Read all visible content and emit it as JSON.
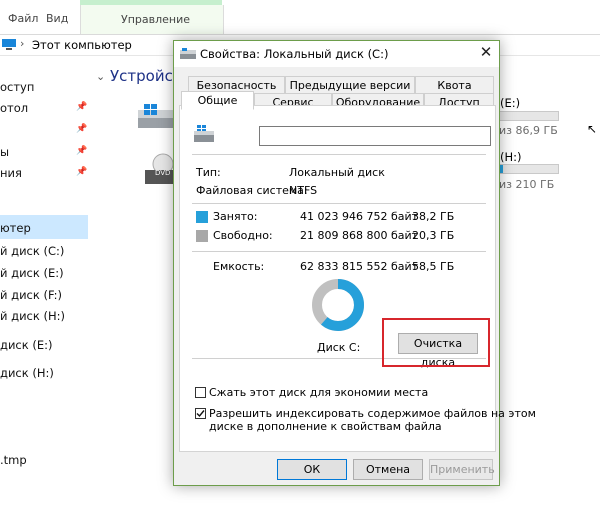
{
  "explorer": {
    "ribbon_tabs": [
      "Файл",
      "Вид"
    ],
    "context_tab_label": "Управление",
    "address_text": "Этот компьютер",
    "section_header": "Устройства",
    "nav_items": [
      "оступ",
      "отол",
      "ы",
      "ния",
      "ютер",
      "й диск (C:)",
      "й диск (E:)",
      "й диск (F:)",
      "й диск (H:)",
      "диск (E:)",
      "диск (H:)",
      ".tmp"
    ],
    "drives_right": [
      {
        "label": "(E:)",
        "free_text": "из 86,9 ГБ"
      },
      {
        "label": "(H:)",
        "free_text": "из 210 ГБ"
      }
    ],
    "dvd_label": "DVD"
  },
  "dialog": {
    "title": "Свойства: Локальный диск (C:)",
    "close_glyph": "✕",
    "tabs_row1": [
      "Безопасность",
      "Предыдущие версии",
      "Квота"
    ],
    "tabs_row2": [
      "Общие",
      "Сервис",
      "Оборудование",
      "Доступ"
    ],
    "active_tab": "Общие",
    "name_input_value": "",
    "type_label": "Тип:",
    "type_value": "Локальный диск",
    "fs_label": "Файловая система:",
    "fs_value": "NTFS",
    "used_label": "Занято:",
    "used_bytes": "41 023 946 752 байт",
    "used_gb": "38,2 ГБ",
    "free_label": "Свободно:",
    "free_bytes": "21 809 868 800 байт",
    "free_gb": "20,3 ГБ",
    "capacity_label": "Емкость:",
    "capacity_bytes": "62 833 815 552 байт",
    "capacity_gb": "58,5 ГБ",
    "disk_caption": "Диск C:",
    "cleanup_button": "Очистка диска",
    "compress_label": "Сжать этот диск для экономии места",
    "compress_checked": false,
    "index_label_line1": "Разрешить индексировать содержимое файлов на этом",
    "index_label_line2": "диске в дополнение к свойствам файла",
    "index_checked": true,
    "ok_button": "ОК",
    "cancel_button": "Отмена",
    "apply_button": "Применить",
    "colors": {
      "used": "#26a0da",
      "free": "#c0c0c0",
      "highlight": "#d7262c"
    }
  }
}
